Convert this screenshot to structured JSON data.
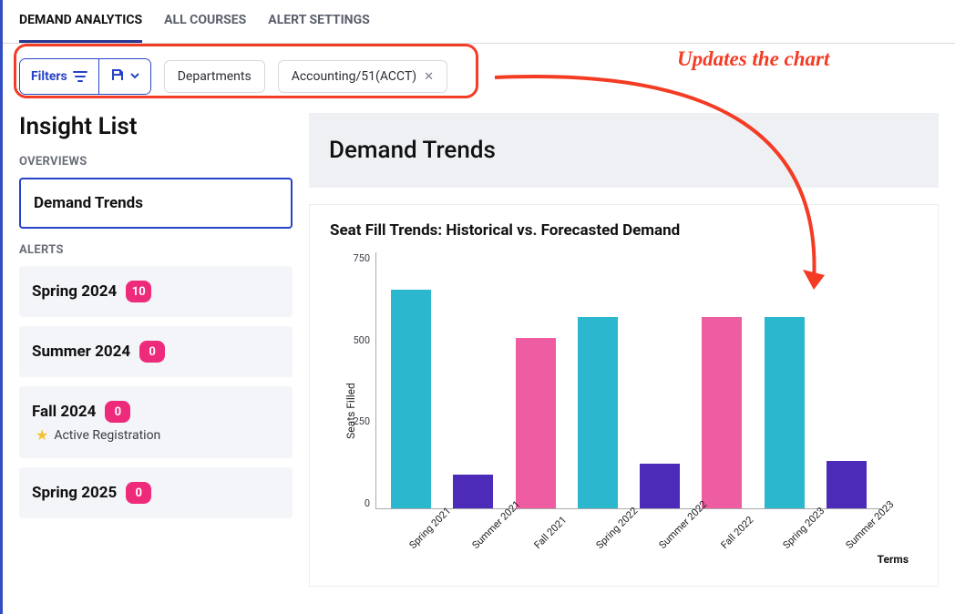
{
  "tabs": {
    "demand_analytics": "DEMAND ANALYTICS",
    "all_courses": "ALL COURSES",
    "alert_settings": "ALERT SETTINGS"
  },
  "filters": {
    "button_label": "Filters",
    "chips": [
      {
        "label": "Departments"
      },
      {
        "label": "Accounting/51(ACCT)"
      }
    ]
  },
  "annotation": {
    "text": "Updates the chart"
  },
  "sidebar": {
    "title": "Insight List",
    "section_overviews": "OVERVIEWS",
    "section_alerts": "ALERTS",
    "items": [
      {
        "label": "Demand Trends"
      }
    ],
    "alerts": [
      {
        "label": "Spring 2024",
        "count": "10"
      },
      {
        "label": "Summer 2024",
        "count": "0"
      },
      {
        "label": "Fall 2024",
        "count": "0",
        "sub": "Active Registration"
      },
      {
        "label": "Spring 2025",
        "count": "0"
      }
    ]
  },
  "main": {
    "header": "Demand Trends",
    "chart_title": "Seat Fill Trends: Historical vs. Forecasted Demand"
  },
  "chart_data": {
    "type": "bar",
    "title": "Seat Fill Trends: Historical vs. Forecasted Demand",
    "xlabel": "Terms",
    "ylabel": "Seats Filled",
    "ylim": [
      0,
      750
    ],
    "y_ticks": [
      "750",
      "500",
      "250",
      "0"
    ],
    "categories": [
      "Spring 2021",
      "Summer 2021",
      "Fall 2021",
      "Spring 2022",
      "Summer 2022",
      "Fall 2022",
      "Spring 2023",
      "Summer 2023"
    ],
    "values": [
      640,
      100,
      500,
      560,
      130,
      560,
      560,
      140
    ],
    "colors": [
      "c-blue",
      "c-purple",
      "c-pink",
      "c-blue",
      "c-purple",
      "c-pink",
      "c-blue",
      "c-purple"
    ]
  }
}
